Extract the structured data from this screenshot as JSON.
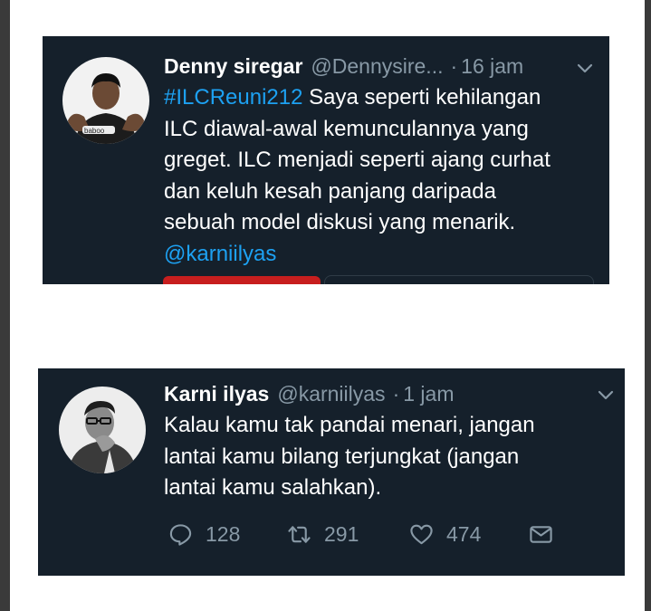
{
  "tweets": [
    {
      "name": "Denny siregar",
      "handle": "@Dennysire...",
      "separator": "·",
      "time": "16 jam",
      "text": {
        "line1_hashtag": "#ILCReuni212",
        "line1_rest": " Saya seperti kehilangan",
        "line2": "ILC diawal-awal kemunculannya yang",
        "line3": "greget. ILC menjadi seperti ajang curhat",
        "line4": "dan keluh kesah panjang daripada",
        "line5": "sebuah model diskusi yang menarik.",
        "mention": "@karniilyas"
      },
      "avatar_icon": "profile-photo-denny"
    },
    {
      "name": "Karni ilyas",
      "handle": "@karniilyas",
      "separator": "·",
      "time": "1 jam",
      "text": {
        "line1": "Kalau kamu tak pandai menari, jangan",
        "line2": "lantai kamu bilang terjungkat (jangan",
        "line3": "lantai kamu salahkan)."
      },
      "avatar_icon": "profile-photo-karni",
      "actions": {
        "reply_count": "128",
        "retweet_count": "291",
        "like_count": "474"
      }
    }
  ],
  "colors": {
    "background": "#15202b",
    "text": "#ffffff",
    "secondary": "#8899a6",
    "link": "#1da1f2",
    "card_accent": "#c71e1e"
  }
}
